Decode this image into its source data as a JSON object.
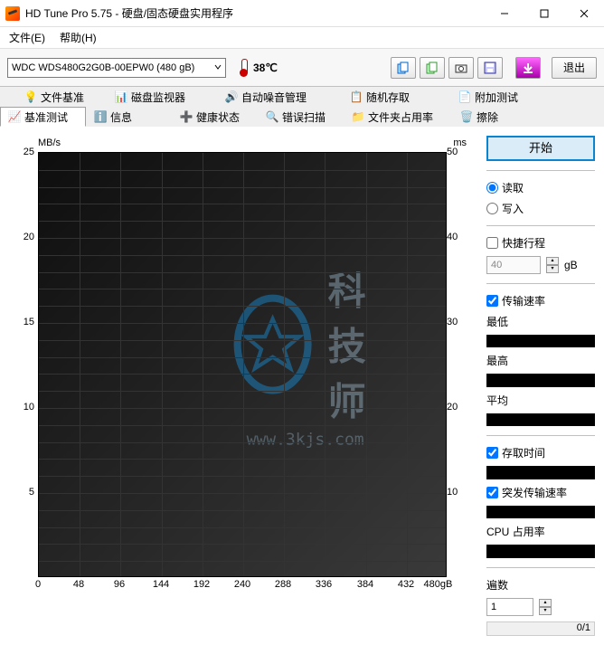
{
  "title": "HD Tune Pro 5.75 - 硬盘/固态硬盘实用程序",
  "menubar": {
    "file": "文件(E)",
    "help": "帮助(H)"
  },
  "toolbar": {
    "drive": "WDC WDS480G2G0B-00EPW0 (480 gB)",
    "temperature": "38℃",
    "exit": "退出"
  },
  "tabs": {
    "top": [
      {
        "id": "file-base",
        "label": "文件基准"
      },
      {
        "id": "disk-monitor",
        "label": "磁盘监视器"
      },
      {
        "id": "noise",
        "label": "自动噪音管理"
      },
      {
        "id": "random",
        "label": "随机存取"
      },
      {
        "id": "extra",
        "label": "附加测试"
      }
    ],
    "bottom": [
      {
        "id": "benchmark",
        "label": "基准测试"
      },
      {
        "id": "info",
        "label": "信息"
      },
      {
        "id": "health",
        "label": "健康状态"
      },
      {
        "id": "error",
        "label": "错误扫描"
      },
      {
        "id": "usage",
        "label": "文件夹占用率"
      },
      {
        "id": "erase",
        "label": "擦除"
      }
    ],
    "active": "benchmark"
  },
  "chart_data": {
    "type": "line",
    "title": "",
    "xlabel": "gB",
    "ylabel_left": "MB/s",
    "ylabel_right": "ms",
    "x_ticks": [
      0,
      48,
      96,
      144,
      192,
      240,
      288,
      336,
      384,
      432,
      "480gB"
    ],
    "y_left_ticks": [
      25,
      20,
      15,
      10,
      5
    ],
    "y_right_ticks": [
      50,
      40,
      30,
      20,
      10
    ],
    "ylim_left": [
      0,
      25
    ],
    "ylim_right": [
      0,
      50
    ],
    "xlim": [
      0,
      480
    ],
    "series": [],
    "grid": true
  },
  "side": {
    "start": "开始",
    "read": "读取",
    "write": "写入",
    "quick": "快捷行程",
    "quick_val": "40",
    "quick_unit": "gB",
    "transfer_rate": "传输速率",
    "min": "最低",
    "max": "最高",
    "avg": "平均",
    "access_time": "存取时间",
    "burst": "突发传输速率",
    "cpu": "CPU 占用率",
    "loops_label": "遍数",
    "loops_val": "1",
    "loop_progress": "0/1"
  },
  "watermark": {
    "text": "科技师",
    "url": "www.3kjs.com"
  }
}
